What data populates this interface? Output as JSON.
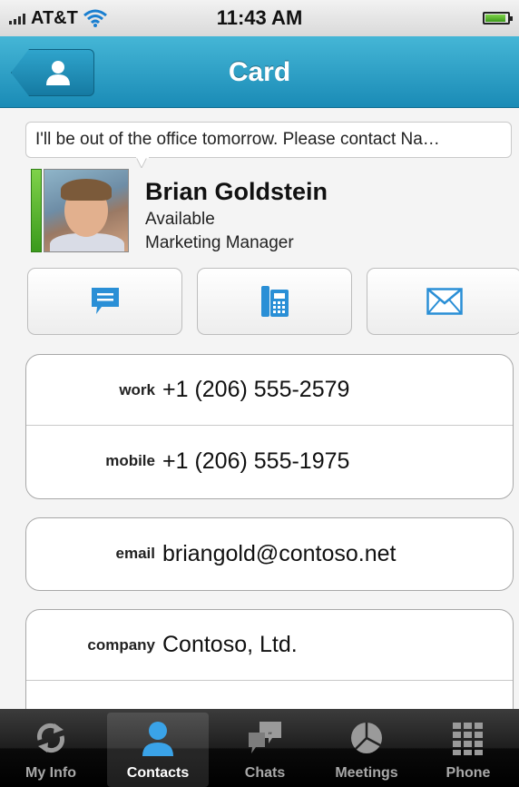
{
  "status_bar": {
    "carrier": "AT&T",
    "time": "11:43 AM"
  },
  "nav": {
    "title": "Card",
    "back_icon": "person-icon"
  },
  "note": {
    "text": "I'll be out of the office tomorrow. Please contact Na…"
  },
  "contact": {
    "name": "Brian Goldstein",
    "availability": "Available",
    "title": "Marketing Manager",
    "presence_color": "#4caf27"
  },
  "actions": [
    {
      "icon": "chat-bubble-icon"
    },
    {
      "icon": "desk-phone-icon"
    },
    {
      "icon": "envelope-icon"
    }
  ],
  "fields": {
    "work": {
      "label": "work",
      "value": "+1 (206) 555-2579"
    },
    "mobile": {
      "label": "mobile",
      "value": "+1 (206) 555-1975"
    },
    "email": {
      "label": "email",
      "value": "briangold@contoso.net"
    },
    "company": {
      "label": "company",
      "value": "Contoso, Ltd."
    }
  },
  "tabs": [
    {
      "label": "My Info",
      "icon": "sync-arrows-icon",
      "active": false
    },
    {
      "label": "Contacts",
      "icon": "person-icon",
      "active": true
    },
    {
      "label": "Chats",
      "icon": "chat-bubbles-icon",
      "active": false
    },
    {
      "label": "Meetings",
      "icon": "clock-pie-icon",
      "active": false
    },
    {
      "label": "Phone",
      "icon": "keypad-icon",
      "active": false
    }
  ],
  "colors": {
    "accent": "#1a8bb6",
    "icon_blue": "#2a8fd6"
  }
}
